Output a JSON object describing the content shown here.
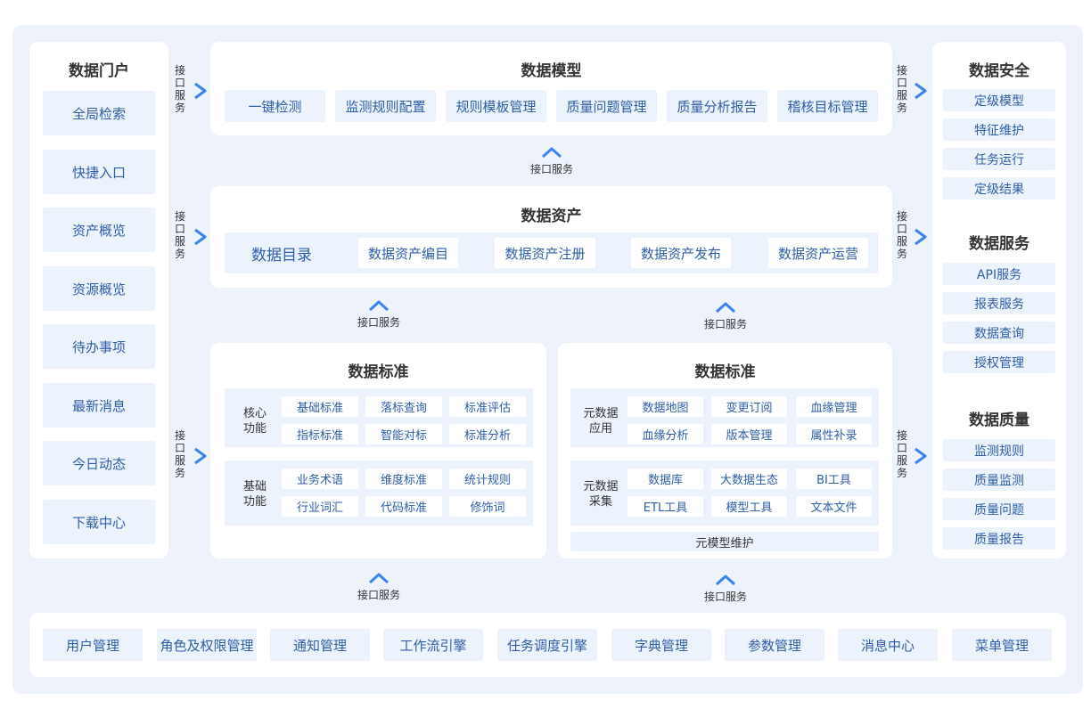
{
  "portal": {
    "title": "数据门户",
    "items": [
      "全局检索",
      "快捷入口",
      "资产概览",
      "资源概览",
      "待办事项",
      "最新消息",
      "今日动态",
      "下载中心"
    ]
  },
  "interface_label": "接口服务",
  "model": {
    "title": "数据模型",
    "items": [
      "一键检测",
      "监测规则配置",
      "规则模板管理",
      "质量问题管理",
      "质量分析报告",
      "稽核目标管理"
    ]
  },
  "assets": {
    "title": "数据资产",
    "lead": "数据目录",
    "items": [
      "数据资产编目",
      "数据资产注册",
      "数据资产发布",
      "数据资产运营"
    ]
  },
  "standard_left": {
    "title": "数据标准",
    "sections": [
      {
        "label": "核心\n功能",
        "items": [
          "基础标准",
          "落标查询",
          "标准评估",
          "指标标准",
          "智能对标",
          "标准分析"
        ]
      },
      {
        "label": "基础\n功能",
        "items": [
          "业务术语",
          "维度标准",
          "统计规则",
          "行业词汇",
          "代码标准",
          "修饰词"
        ]
      }
    ]
  },
  "standard_right": {
    "title": "数据标准",
    "sections": [
      {
        "label": "元数据\n应用",
        "items": [
          "数据地图",
          "变更订阅",
          "血缘管理",
          "血缘分析",
          "版本管理",
          "属性补录"
        ]
      },
      {
        "label": "元数据\n采集",
        "items": [
          "数据库",
          "大数据生态",
          "BI工具",
          "ETL工具",
          "模型工具",
          "文本文件"
        ]
      }
    ],
    "footer": "元模型维护"
  },
  "security": {
    "title": "数据安全",
    "items": [
      "定级模型",
      "特征维护",
      "任务运行",
      "定级结果"
    ]
  },
  "service": {
    "title": "数据服务",
    "items": [
      "API服务",
      "报表服务",
      "数据查询",
      "授权管理"
    ]
  },
  "quality": {
    "title": "数据质量",
    "items": [
      "监测规则",
      "质量监测",
      "质量问题",
      "质量报告"
    ]
  },
  "bottom": {
    "items": [
      "用户管理",
      "角色及权限管理",
      "通知管理",
      "工作流引擎",
      "任务调度引擎",
      "字典管理",
      "参数管理",
      "消息中心",
      "菜单管理"
    ]
  },
  "colors": {
    "accent": "#3c82f0",
    "item_bg": "#edf3fd",
    "item_text": "#2e5da9",
    "canvas": "#edf2fb"
  }
}
